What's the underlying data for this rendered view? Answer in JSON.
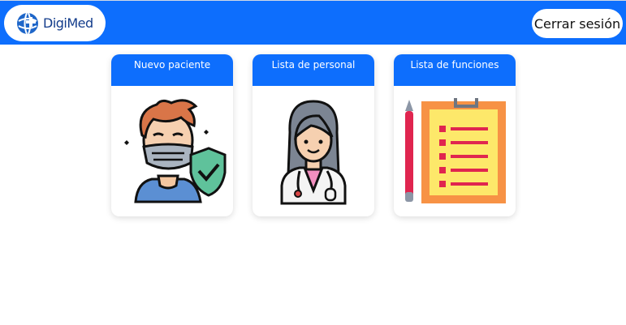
{
  "header": {
    "brand": "DigiMed",
    "logout_label": "Cerrar sesión",
    "color": "#0d6efd"
  },
  "cards": [
    {
      "title": "Nuevo paciente",
      "icon": "masked-patient-shield-icon"
    },
    {
      "title": "Lista de personal",
      "icon": "female-doctor-icon"
    },
    {
      "title": "Lista de funciones",
      "icon": "clipboard-checklist-icon"
    }
  ]
}
